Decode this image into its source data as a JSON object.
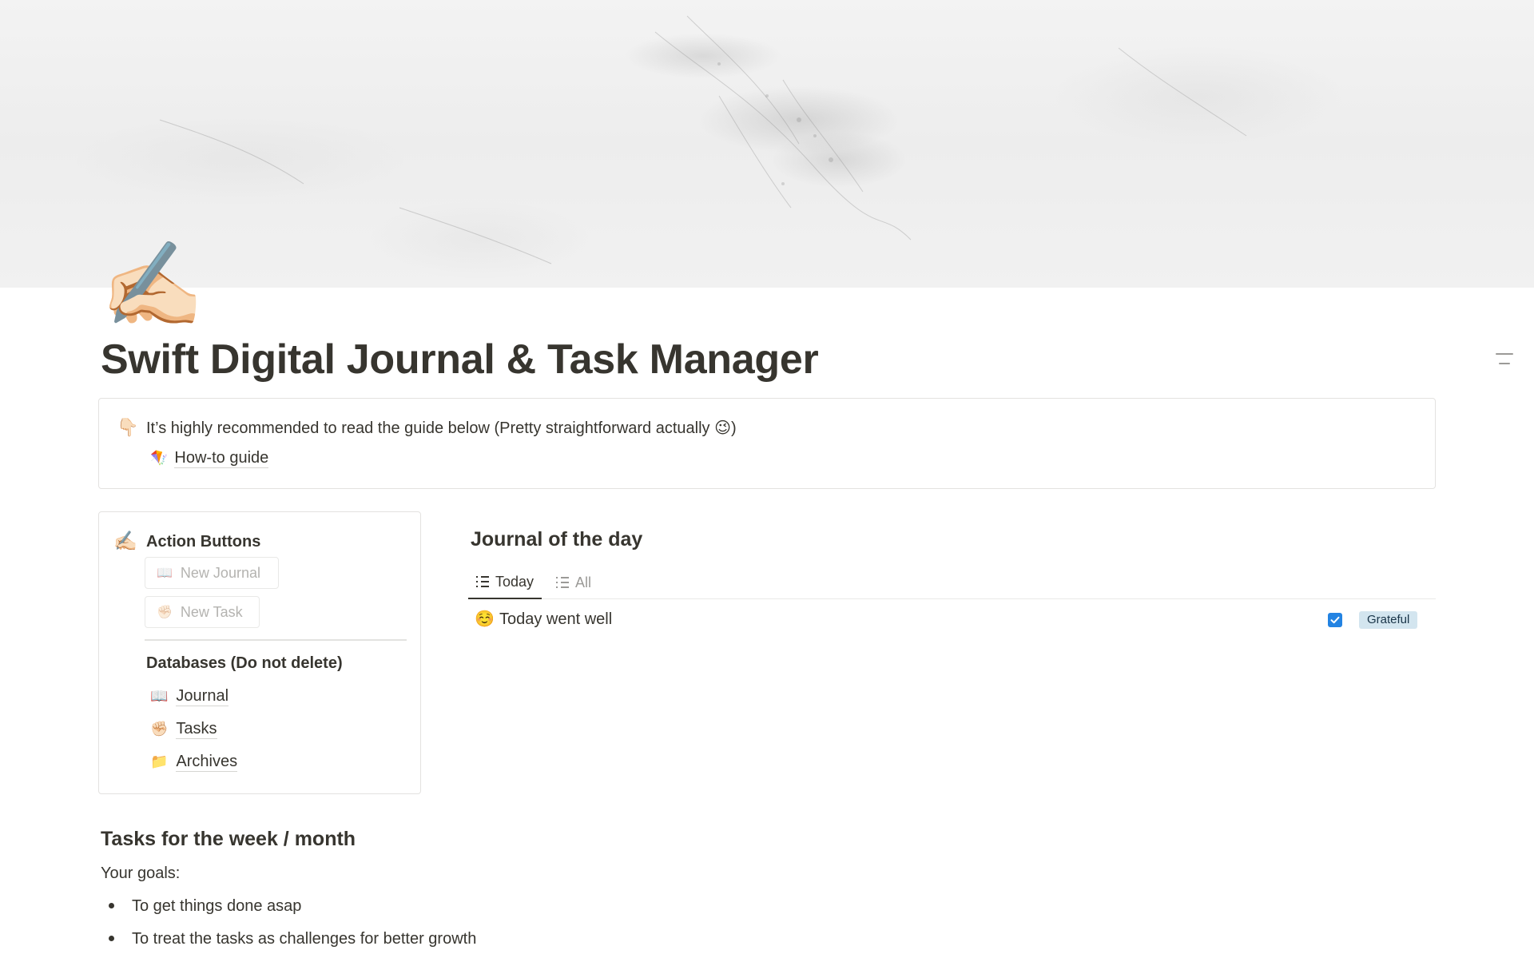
{
  "page": {
    "icon": "✍🏻",
    "title": "Swift Digital Journal & Task Manager"
  },
  "callout": {
    "emoji": "👇🏻",
    "text": "It’s highly recommended to read the guide below (Pretty straightforward actually 😉)",
    "link": {
      "emoji": "🪁",
      "label": "How-to guide"
    }
  },
  "action_card": {
    "emoji": "✍🏻",
    "heading": "Action Buttons",
    "buttons": [
      {
        "emoji": "📖",
        "label": "New Journal"
      },
      {
        "emoji": "✊🏻",
        "label": "New Task"
      }
    ],
    "databases_heading": "Databases (Do not delete)",
    "databases": [
      {
        "emoji": "📖",
        "label": "Journal"
      },
      {
        "emoji": "✊🏻",
        "label": "Tasks"
      },
      {
        "emoji": "📁",
        "label": "Archives"
      }
    ]
  },
  "journal_view": {
    "title": "Journal of the day",
    "tabs": [
      {
        "label": "Today",
        "active": true
      },
      {
        "label": "All",
        "active": false
      }
    ],
    "rows": [
      {
        "emoji": "☺️",
        "title": "Today went well",
        "checked": true,
        "tag": "Grateful",
        "tag_color": "#d3e5ef"
      }
    ]
  },
  "tasks_section": {
    "heading": "Tasks for the week / month",
    "goals_label": "Your goals:",
    "goals": [
      "To get things done asap",
      "To treat the tasks as challenges for better growth"
    ]
  },
  "colors": {
    "text": "#37352f",
    "accent_blue": "#2383e2",
    "border": "#e3e2e0"
  }
}
